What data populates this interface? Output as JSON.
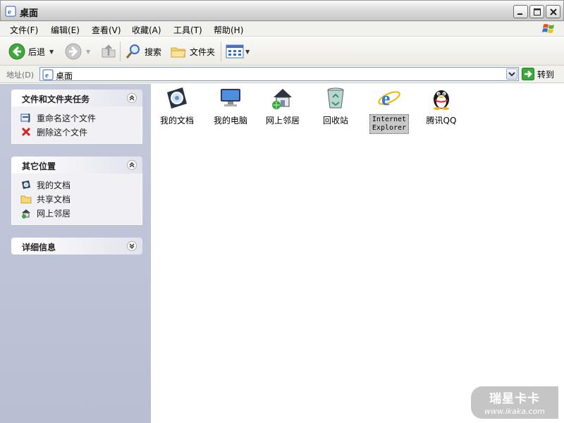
{
  "window": {
    "title": "桌面"
  },
  "menu": [
    "文件(F)",
    "编辑(E)",
    "查看(V)",
    "收藏(A)",
    "工具(T)",
    "帮助(H)"
  ],
  "toolbar": {
    "back": "后退",
    "search": "搜索",
    "folders": "文件夹"
  },
  "address": {
    "label": "地址(D)",
    "value": "桌面",
    "go": "转到"
  },
  "panels": [
    {
      "title": "文件和文件夹任务",
      "items": [
        "重命名这个文件",
        "删除这个文件"
      ]
    },
    {
      "title": "其它位置",
      "items": [
        "我的文档",
        "共享文档",
        "网上邻居"
      ]
    },
    {
      "title": "详细信息",
      "items": []
    }
  ],
  "desktop_icons": [
    {
      "label": "我的文档",
      "icon": "my-documents-icon"
    },
    {
      "label": "我的电脑",
      "icon": "my-computer-icon"
    },
    {
      "label": "网上邻居",
      "icon": "network-places-icon"
    },
    {
      "label": "回收站",
      "icon": "recycle-bin-icon"
    },
    {
      "label": "Internet Explorer",
      "icon": "internet-explorer-icon",
      "selected": true
    },
    {
      "label": "腾讯QQ",
      "icon": "qq-penguin-icon"
    }
  ],
  "watermark": {
    "line1": "瑞星卡卡",
    "line2": "www.ikaka.com"
  },
  "colors": {
    "pane_bg": "#c4c9dc",
    "go_green": "#3ea83a",
    "addr_border": "#7f9db9"
  }
}
